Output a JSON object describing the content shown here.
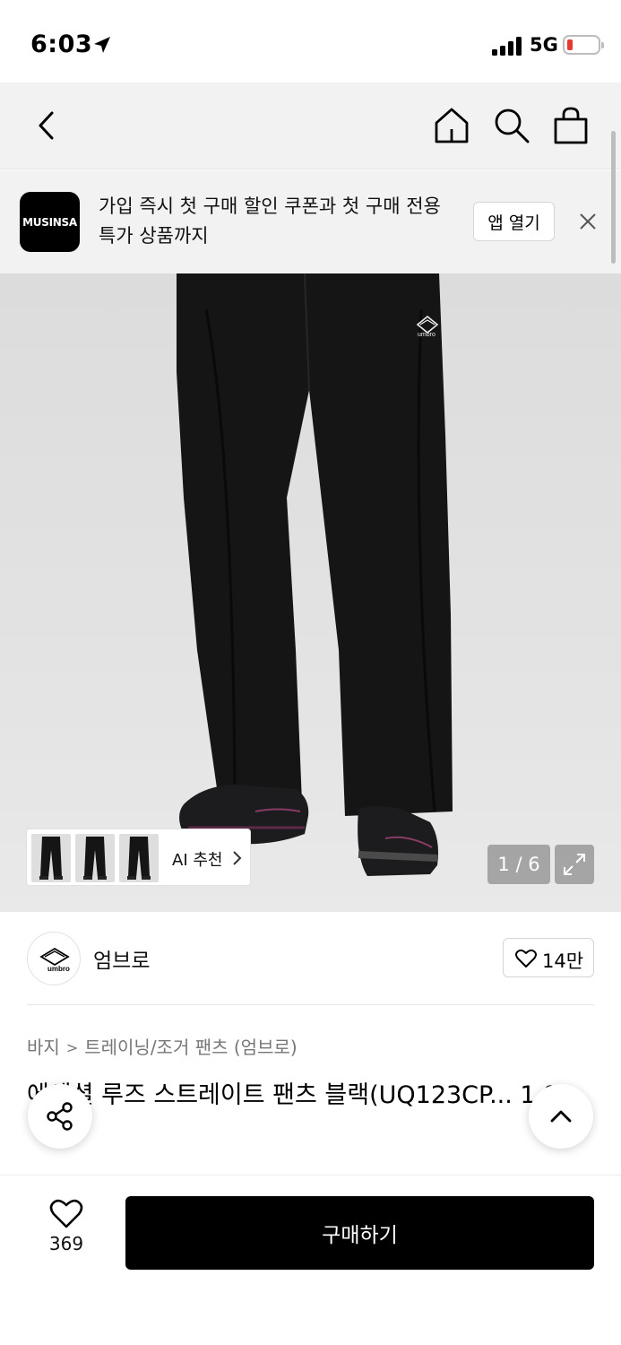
{
  "status_bar": {
    "time": "6:03",
    "network": "5G",
    "battery_level": 0.1
  },
  "nav": {
    "icons": [
      "back-icon",
      "home-icon",
      "search-icon",
      "shopping-bag-icon"
    ]
  },
  "app_banner": {
    "logo_text": "MUSINSA",
    "message": "가입 즉시 첫 구매 할인 쿠폰과 첫 구매 전용 특가 상품까지",
    "open_button": "앱 열기"
  },
  "gallery": {
    "ai_recommend_label": "AI 추천",
    "counter": "1 / 6",
    "logo_text": "umbro"
  },
  "brand": {
    "name": "엄브로",
    "logo_text": "umbro",
    "likes": "14만"
  },
  "product": {
    "breadcrumb": [
      "바지",
      "트레이닝/조거 팬츠 (엄브로)"
    ],
    "title": "에센셜 루즈 스트레이트 팬츠 블랙(UQ123CP... 1 8)"
  },
  "bottom_bar": {
    "wish_count": "369",
    "buy_label": "구매하기"
  },
  "colors": {
    "accent": "#000000",
    "background": "#ffffff",
    "nav_background": "#f2f2f2",
    "battery_low": "#e53935"
  }
}
